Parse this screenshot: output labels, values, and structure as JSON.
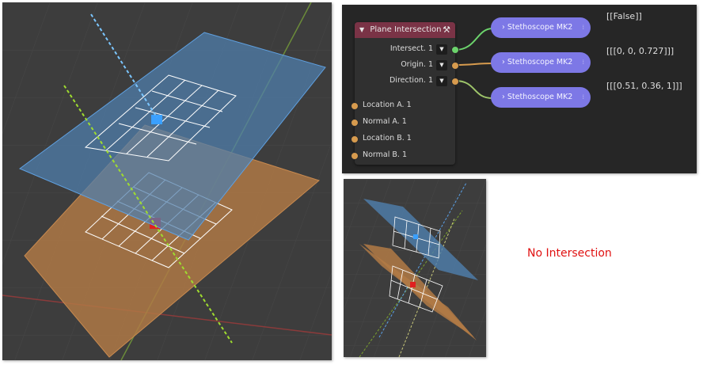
{
  "node": {
    "title": "Plane Intersection",
    "outputs": [
      "Intersect. 1",
      "Origin. 1",
      "Direction. 1"
    ],
    "inputs": [
      "Location A. 1",
      "Normal A. 1",
      "Location B. 1",
      "Normal B. 1"
    ],
    "header_color": "#7a3346"
  },
  "stethoscopes": [
    {
      "label": "Stethoscope MK2",
      "value": "[[False]]"
    },
    {
      "label": "Stethoscope MK2",
      "value": "[[[0, 0, 0.727]]]"
    },
    {
      "label": "Stethoscope MK2",
      "value": "[[[0.51, 0.36, 1]]]"
    }
  ],
  "caption": "No Intersection",
  "colors": {
    "viewport_bg": "#3d3d3d",
    "editor_bg": "#262626",
    "plane_a": "#4f7fae",
    "plane_b": "#b27a45",
    "stethoscope": "#7d78e6",
    "caption": "#e01010"
  },
  "icons": [
    "chevron-down-icon",
    "wrench-icon",
    "dropdown-arrow-icon"
  ]
}
